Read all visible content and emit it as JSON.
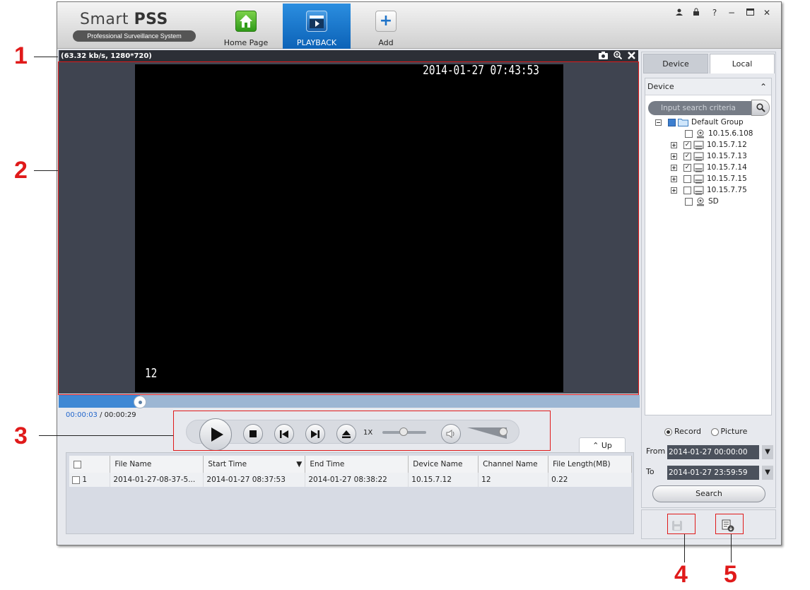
{
  "app": {
    "title_light": "Smart",
    "title_bold": "PSS",
    "subtitle": "Professional Surveillance System"
  },
  "nav": [
    {
      "label": "Home Page",
      "icon": "home-icon"
    },
    {
      "label": "PLAYBACK",
      "icon": "clapperboard-icon",
      "active": true
    },
    {
      "label": "Add",
      "icon": "plus-icon"
    }
  ],
  "window_controls": [
    "user-icon",
    "lock-icon",
    "help-icon",
    "minimize-icon",
    "maximize-icon",
    "close-icon"
  ],
  "video": {
    "info": "(63.32 kb/s, 1280*720)",
    "timestamp": "2014-01-27 07:43:53",
    "channel_overlay": "12"
  },
  "playback": {
    "current_time": "00:00:03",
    "separator": " / ",
    "total_time": "00:00:29",
    "progress_fraction": 0.14,
    "speed": "1X"
  },
  "up_tab": "Up",
  "table": {
    "headers": [
      "File Name",
      "Start Time",
      "End Time",
      "Device Name",
      "Channel Name",
      "File Length(MB)"
    ],
    "rows": [
      {
        "index": "1",
        "file_name": "2014-01-27-08-37-5...",
        "start": "2014-01-27 08:37:53",
        "end": "2014-01-27 08:38:22",
        "device": "10.15.7.12",
        "channel": "12",
        "length": "0.22"
      }
    ]
  },
  "right_panel": {
    "tabs": [
      "Device",
      "Local"
    ],
    "section_title": "Device",
    "search_placeholder": "Input search criteria",
    "tree": {
      "group": "Default Group",
      "items": [
        {
          "label": "10.15.6.108",
          "checked": false,
          "expandable": false,
          "icon": "camera-icon"
        },
        {
          "label": "10.15.7.12",
          "checked": true,
          "expandable": true,
          "icon": "dvr-icon"
        },
        {
          "label": "10.15.7.13",
          "checked": true,
          "expandable": true,
          "icon": "dvr-icon"
        },
        {
          "label": "10.15.7.14",
          "checked": true,
          "expandable": true,
          "icon": "dvr-icon"
        },
        {
          "label": "10.15.7.15",
          "checked": false,
          "expandable": true,
          "icon": "dvr-icon"
        },
        {
          "label": "10.15.7.75",
          "checked": false,
          "expandable": true,
          "icon": "dvr-icon"
        },
        {
          "label": "SD",
          "checked": false,
          "expandable": false,
          "icon": "camera-icon"
        }
      ]
    },
    "type_record": "Record",
    "type_picture": "Picture",
    "from_label": "From",
    "from_value": "2014-01-27 00:00:00",
    "to_label": "To",
    "to_value": "2014-01-27 23:59:59",
    "search_button": "Search"
  },
  "callouts": [
    "1",
    "2",
    "3",
    "4",
    "5"
  ],
  "colors": {
    "annotation": "#e01a1a",
    "accent": "#0c62b7"
  }
}
